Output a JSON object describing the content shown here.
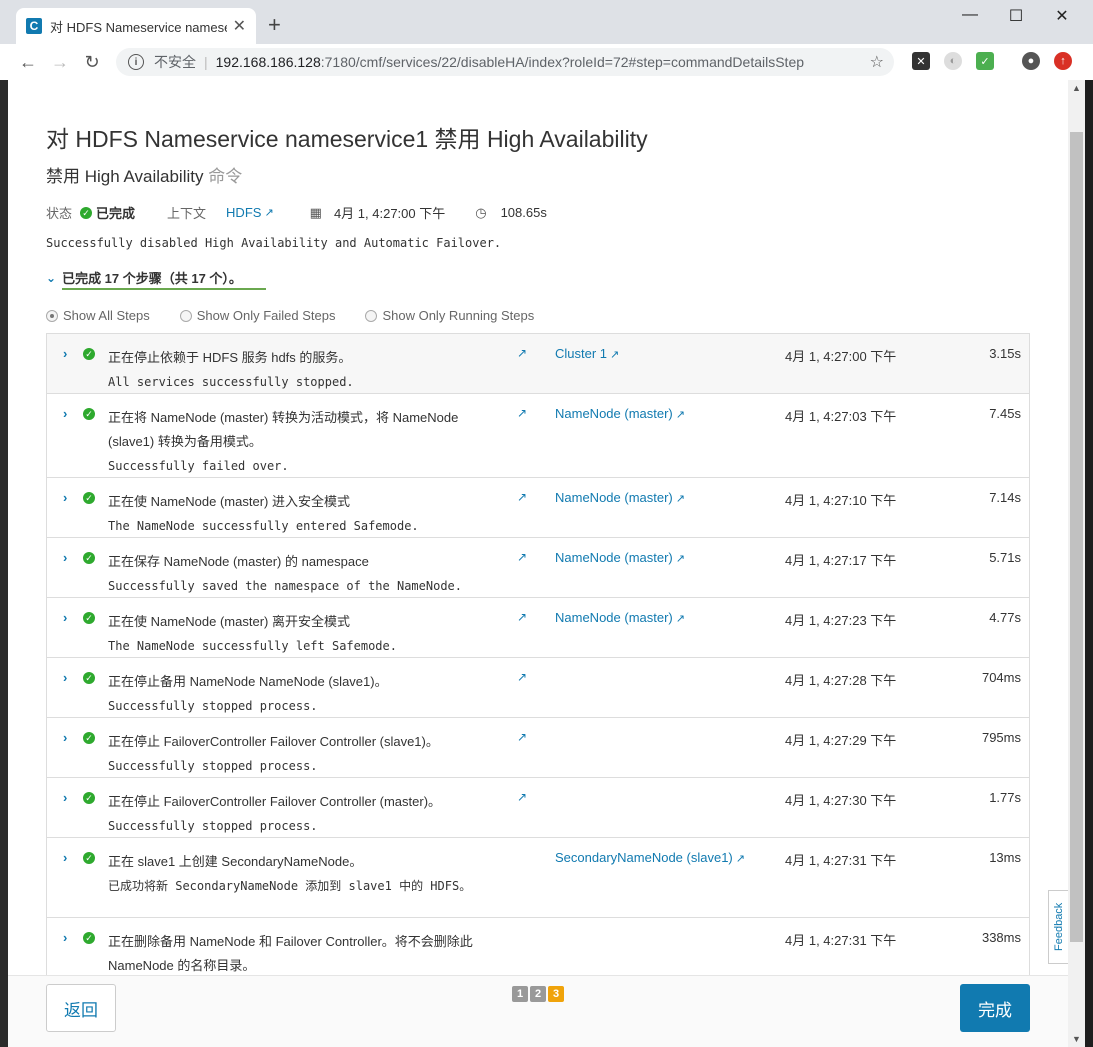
{
  "browser": {
    "tab_title": "对 HDFS Nameservice nameservice1 禁用 High Availability",
    "favicon_letter": "C",
    "insecure_label": "不安全",
    "url_host": "192.168.186.128",
    "url_path": ":7180/cmf/services/22/disableHA/index?roleId=72#step=commandDetailsStep"
  },
  "page": {
    "title": "对 HDFS Nameservice nameservice1 禁用 High Availability",
    "subtitle": "禁用 High Availability",
    "subtitle_suffix": "命令",
    "status_label": "状态",
    "status_value": "已完成",
    "context_label": "上下文",
    "context_link": "HDFS",
    "start_time": "4月 1, 4:27:00 下午",
    "duration": "108.65s",
    "summary": "Successfully disabled High Availability and Automatic Failover.",
    "steps_summary": "已完成 17 个步骤（共 17 个）。"
  },
  "filters": [
    "Show All Steps",
    "Show Only Failed Steps",
    "Show Only Running Steps"
  ],
  "steps": [
    {
      "desc": "正在停止依赖于 HDFS 服务 hdfs 的服务。",
      "result": "All services successfully stopped.",
      "target": "Cluster 1",
      "time": "4月 1, 4:27:00 下午",
      "dur": "3.15s"
    },
    {
      "desc": "正在将 NameNode (master) 转换为活动模式，将 NameNode (slave1) 转换为备用模式。",
      "result": "Successfully failed over.",
      "target": "NameNode (master)",
      "time": "4月 1, 4:27:03 下午",
      "dur": "7.45s"
    },
    {
      "desc": "正在使 NameNode (master) 进入安全模式",
      "result": "The NameNode successfully entered Safemode.",
      "target": "NameNode (master)",
      "time": "4月 1, 4:27:10 下午",
      "dur": "7.14s"
    },
    {
      "desc": "正在保存 NameNode (master) 的 namespace",
      "result": "Successfully saved the namespace of the NameNode.",
      "target": "NameNode (master)",
      "time": "4月 1, 4:27:17 下午",
      "dur": "5.71s"
    },
    {
      "desc": "正在使 NameNode (master) 离开安全模式",
      "result": "The NameNode successfully left Safemode.",
      "target": "NameNode (master)",
      "time": "4月 1, 4:27:23 下午",
      "dur": "4.77s"
    },
    {
      "desc": "正在停止备用 NameNode NameNode (slave1)。",
      "result": "Successfully stopped process.",
      "target": "",
      "time": "4月 1, 4:27:28 下午",
      "dur": "704ms"
    },
    {
      "desc": "正在停止 FailoverController Failover Controller (slave1)。",
      "result": "Successfully stopped process.",
      "target": "",
      "time": "4月 1, 4:27:29 下午",
      "dur": "795ms"
    },
    {
      "desc": "正在停止 FailoverController Failover Controller (master)。",
      "result": "Successfully stopped process.",
      "target": "",
      "time": "4月 1, 4:27:30 下午",
      "dur": "1.77s"
    },
    {
      "desc": "正在 slave1 上创建 SecondaryNameNode。",
      "result": "已成功将新 SecondaryNameNode 添加到 slave1 中的 HDFS。",
      "target": "SecondaryNameNode (slave1)",
      "time": "4月 1, 4:27:31 下午",
      "dur": "13ms"
    },
    {
      "desc": "正在删除备用 NameNode 和 Failover Controller。将不会删除此 NameNode 的名称目录。",
      "result": "",
      "target": "",
      "time": "4月 1, 4:27:31 下午",
      "dur": "338ms"
    }
  ],
  "footer": {
    "back_label": "返回",
    "done_label": "完成",
    "pages": [
      "1",
      "2",
      "3"
    ]
  },
  "feedback_label": "Feedback"
}
